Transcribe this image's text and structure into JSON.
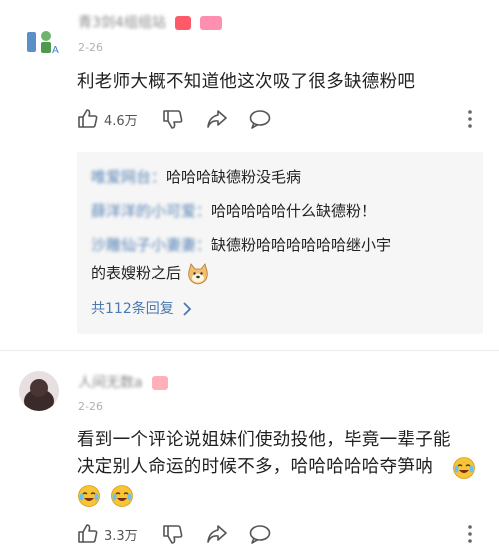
{
  "comments": [
    {
      "username": "青3剑4组组站",
      "date": "2-26",
      "text": "利老师大概不知道他这次吸了很多缺德粉吧",
      "likes": "4.6万",
      "replies": [
        {
          "name": "唯爱网台：",
          "text": "哈哈哈缺德粉没毛病"
        },
        {
          "name": "薛洋洋的小可爱：",
          "text": "哈哈哈哈哈什么缺德粉！"
        },
        {
          "name": "沙雕仙子小妻妻：",
          "text": "缺德粉哈哈哈哈哈哈继小宇",
          "text2": "的表嫂粉之后"
        }
      ],
      "more_replies": "共112条回复"
    },
    {
      "username": "人间无数a",
      "date": "2-26",
      "text_line1": "看到一个评论说姐妹们使劲投他，毕竟一辈子能",
      "text_line2": "决定别人命运的时候不多，哈哈哈哈哈夺笋呐",
      "likes": "3.3万"
    }
  ],
  "icons": [
    "thumb-up-icon",
    "thumb-down-icon",
    "share-icon",
    "comment-icon",
    "more-vertical-icon",
    "doge-emoji-icon",
    "crying-laugh-emoji-icon"
  ],
  "colors": {
    "reply_name": "#5a86b8",
    "more_link": "#4a78b0",
    "reply_bg": "#f6f6f6",
    "badge": "#ff5a6a"
  }
}
